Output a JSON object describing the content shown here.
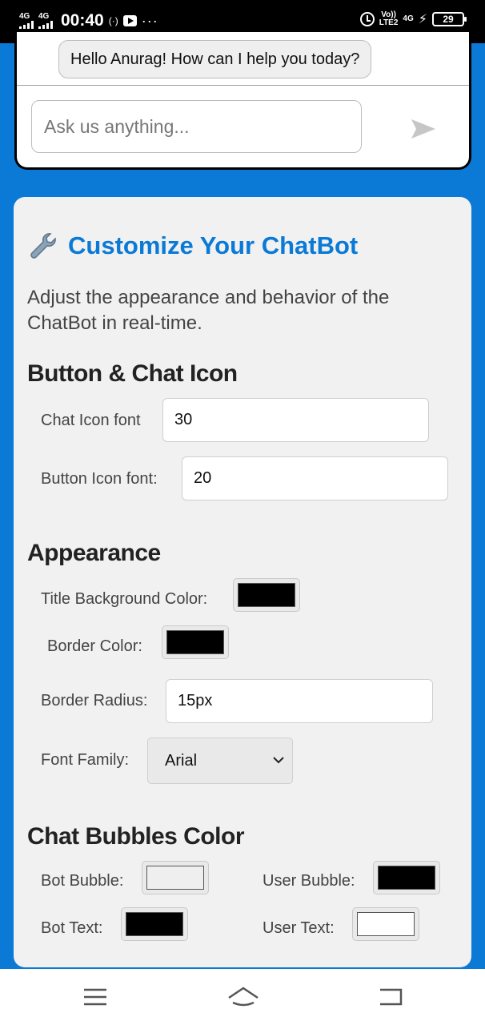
{
  "status_bar": {
    "sim1": "4G",
    "sim2": "4G",
    "time": "00:40",
    "hotspot": "(·)",
    "more": "···",
    "volte_top": "Vo))",
    "volte_bottom": "LTE2",
    "net": "4G",
    "battery": "29"
  },
  "chat": {
    "bot_message": "Hello Anurag! How can I help you today?",
    "input_placeholder": "Ask us anything..."
  },
  "customize": {
    "title": "Customize Your ChatBot",
    "description": "Adjust the appearance and behavior of the ChatBot in real-time.",
    "button_chat_icon": {
      "heading": "Button & Chat Icon",
      "chat_icon_font_label": "Chat Icon font",
      "chat_icon_font_value": "30",
      "button_icon_font_label": "Button Icon font:",
      "button_icon_font_value": "20"
    },
    "appearance": {
      "heading": "Appearance",
      "title_bg_label": "Title Background Color:",
      "title_bg_color": "#000000",
      "border_color_label": "Border Color:",
      "border_color": "#000000",
      "border_radius_label": "Border Radius:",
      "border_radius_value": "15px",
      "font_family_label": "Font Family:",
      "font_family_value": "Arial"
    },
    "bubbles": {
      "heading": "Chat Bubbles Color",
      "bot_bubble_label": "Bot Bubble:",
      "bot_bubble_color": "#efefef",
      "user_bubble_label": "User Bubble:",
      "user_bubble_color": "#000000",
      "bot_text_label": "Bot Text:",
      "bot_text_color": "#000000",
      "user_text_label": "User Text:",
      "user_text_color": "#ffffff"
    }
  },
  "colors": {
    "accent": "#0a7ad6",
    "panel_bg": "#f1f1f1"
  },
  "icons": {
    "panel_title": "wrench-icon",
    "send": "send-icon",
    "nav_menu": "menu-icon",
    "nav_home": "home-icon",
    "nav_back": "back-icon"
  }
}
